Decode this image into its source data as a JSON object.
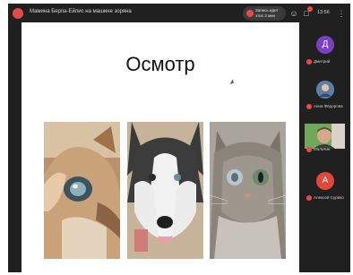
{
  "window": {
    "title": "Мамина Берла-Ейлис на машине зоряна",
    "time": "13:56"
  },
  "recording": {
    "label": "Запись идет этих 3 мин"
  },
  "icons": {
    "app_logo": "conference-logo-icon",
    "people": "people-icon",
    "chat": "chat-icon",
    "menu": "more-icon",
    "record": "record-dot-icon",
    "mic_muted": "mic-muted-icon",
    "cursor": "mouse-cursor-icon"
  },
  "slide": {
    "title": "Осмотр",
    "photos": [
      {
        "name": "cat-eye-closeup"
      },
      {
        "name": "husky-dog"
      },
      {
        "name": "gray-cat"
      }
    ]
  },
  "participants": [
    {
      "initial": "Д",
      "name": "Дмитрий",
      "color": "#7b3fc4"
    },
    {
      "initial": "",
      "name": "Анна Фёдорова",
      "color": "#3a6ea5"
    },
    {
      "initial": "",
      "name": "Мальчин",
      "color": "#6fa85a",
      "video": true
    },
    {
      "initial": "А",
      "name": "Алексей Суриков",
      "color": "#e0483a"
    }
  ],
  "colors": {
    "background": "#1f1f1f",
    "accent_red": "#e64a4a"
  }
}
